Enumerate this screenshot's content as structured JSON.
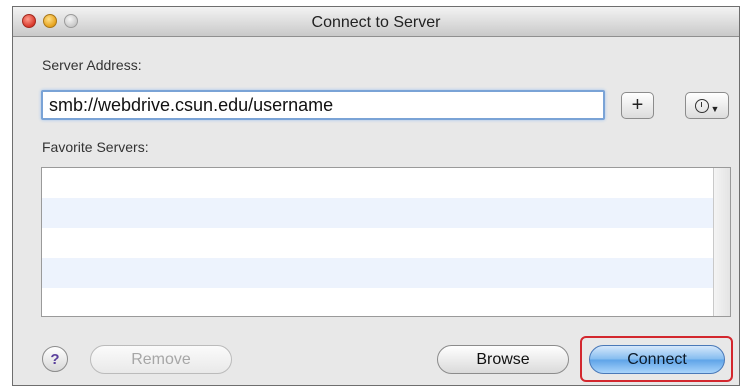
{
  "window": {
    "title": "Connect to Server"
  },
  "server_address": {
    "label": "Server Address:",
    "value": "smb://webdrive.csun.edu/username",
    "add_button_label": "+"
  },
  "favorites": {
    "label": "Favorite Servers:"
  },
  "buttons": {
    "help": "?",
    "remove": "Remove",
    "browse": "Browse",
    "connect": "Connect"
  },
  "icons": {
    "add": "plus-icon",
    "recent_servers": "clock-icon",
    "dropdown": "chevron-down-icon",
    "help": "question-icon"
  },
  "colors": {
    "highlight": "#d3272e",
    "connect_button": "#5fa4e8",
    "focus_ring": "#7aa3d6"
  }
}
